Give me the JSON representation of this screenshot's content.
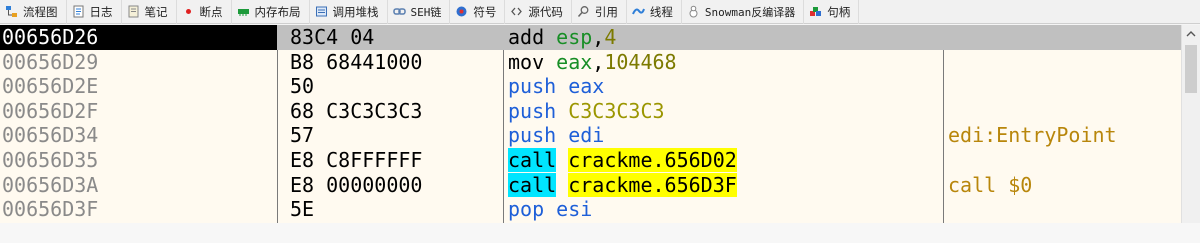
{
  "tabs": [
    {
      "label": "流程图",
      "icon": "flowchart-icon"
    },
    {
      "label": "日志",
      "icon": "log-icon"
    },
    {
      "label": "笔记",
      "icon": "notes-icon"
    },
    {
      "label": "断点",
      "icon": "breakpoint-icon"
    },
    {
      "label": "内存布局",
      "icon": "memory-map-icon"
    },
    {
      "label": "调用堆栈",
      "icon": "call-stack-icon"
    },
    {
      "label": "SEH链",
      "icon": "seh-chain-icon"
    },
    {
      "label": "符号",
      "icon": "symbols-icon"
    },
    {
      "label": "源代码",
      "icon": "source-code-icon"
    },
    {
      "label": "引用",
      "icon": "references-icon"
    },
    {
      "label": "线程",
      "icon": "threads-icon"
    },
    {
      "label": "Snowman反编译器",
      "icon": "snowman-decompiler-icon"
    },
    {
      "label": "句柄",
      "icon": "handles-icon"
    }
  ],
  "disassembly": {
    "rows": [
      {
        "addr": "00656D26",
        "bytes": "83C4 04",
        "mnemonic": "add",
        "op1": "esp",
        "sep": ",",
        "op2": "4",
        "comment": ""
      },
      {
        "addr": "00656D29",
        "bytes": "B8 68441000",
        "mnemonic": "mov",
        "op1": "eax",
        "sep": ",",
        "op2": "104468",
        "comment": ""
      },
      {
        "addr": "00656D2E",
        "bytes": "50",
        "mnemonic": "push",
        "op1": "eax",
        "sep": "",
        "op2": "",
        "comment": ""
      },
      {
        "addr": "00656D2F",
        "bytes": "68 C3C3C3C3",
        "mnemonic": "push",
        "op1": "C3C3C3C3",
        "sep": "",
        "op2": "",
        "comment": ""
      },
      {
        "addr": "00656D34",
        "bytes": "57",
        "mnemonic": "push",
        "op1": "edi",
        "sep": "",
        "op2": "",
        "comment": "edi:EntryPoint"
      },
      {
        "addr": "00656D35",
        "bytes": "E8 C8FFFFFF",
        "mnemonic": "call",
        "op1": "crackme.656D02",
        "sep": "",
        "op2": "",
        "comment": ""
      },
      {
        "addr": "00656D3A",
        "bytes": "E8 00000000",
        "mnemonic": "call",
        "op1": "crackme.656D3F",
        "sep": "",
        "op2": "",
        "comment": "call $0"
      },
      {
        "addr": "00656D3F",
        "bytes": "5E",
        "mnemonic": "pop",
        "op1": "esi",
        "sep": "",
        "op2": "",
        "comment": ""
      }
    ],
    "selected_row": 0
  },
  "colors": {
    "selection": "#c0c0c0",
    "call_highlight": "#00e5ff",
    "call_target_highlight": "#ffff00",
    "register": "#188e26",
    "push": "#1e5fd8",
    "comment": "#b8860b"
  }
}
